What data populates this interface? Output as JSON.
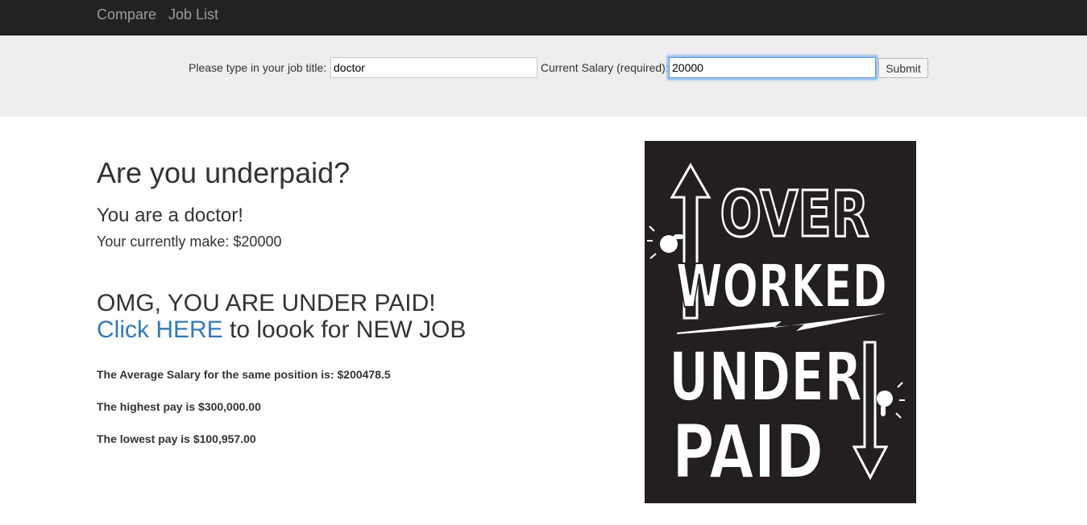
{
  "nav": {
    "compare": "Compare",
    "job_list": "Job List"
  },
  "search": {
    "job_label": "Please type in your job title:",
    "job_value": "doctor",
    "salary_label": "Current Salary (required):",
    "salary_value": "20000",
    "submit_label": "Submit"
  },
  "result": {
    "title": "Are you underpaid?",
    "job_line": "You are a doctor!",
    "make_line": "Your currently make: $20000",
    "verdict": "OMG, YOU ARE UNDER PAID!",
    "cta_link": "Click HERE",
    "cta_rest": " to loook for NEW JOB",
    "average": "The Average Salary for the same position is: $200478.5",
    "highest": "The highest pay is $300,000.00",
    "lowest": "The lowest pay is $100,957.00"
  },
  "poster": {
    "line1": "OVER",
    "line2": "WORKED",
    "line3": "UNDER",
    "line4": "PAID"
  },
  "colors": {
    "navbar": "#222222",
    "searchbar": "#eeeeee",
    "link": "#337ab7",
    "poster_bg": "#231f20"
  }
}
